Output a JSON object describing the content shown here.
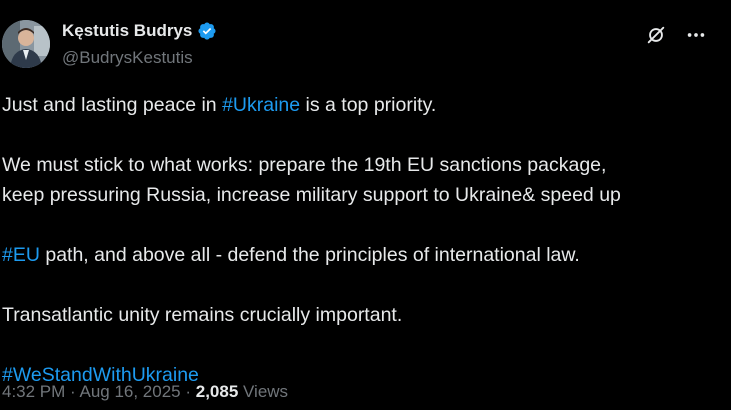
{
  "author": {
    "display_name": "Kęstutis Budrys",
    "handle": "@BudrysKestutis",
    "verified_badge_icon": "verified-badge-icon",
    "badge_color": "#1d9bf0"
  },
  "actions": {
    "grok_icon": "grok-icon",
    "more_icon": "more-options-icon",
    "more_glyph": "···"
  },
  "tweet": {
    "line1_before": "Just and lasting peace in ",
    "line1_hashtag": "#Ukraine",
    "line1_after": " is a top priority.",
    "para2_line1": "We must stick to what works: prepare the 19th EU sanctions package,",
    "para2_line2": "keep pressuring Russia, increase military support to Ukraine& speed up",
    "para2_line3_flag": "ukraine-flag-emoji",
    "para2_line3_hashtag": "#EU",
    "para2_line3_after": " path, and above all - defend the principles of international law.",
    "para3": "Transatlantic unity remains crucially important.",
    "hashtag_final": "#WeStandWithUkraine"
  },
  "meta": {
    "time": "4:32 PM",
    "separator": " · ",
    "date": "Aug 16, 2025",
    "views_count": "2,085",
    "views_label": " Views"
  },
  "colors": {
    "background": "#000000",
    "text": "#e7e9ea",
    "secondary": "#71767b",
    "link": "#1d9bf0"
  }
}
